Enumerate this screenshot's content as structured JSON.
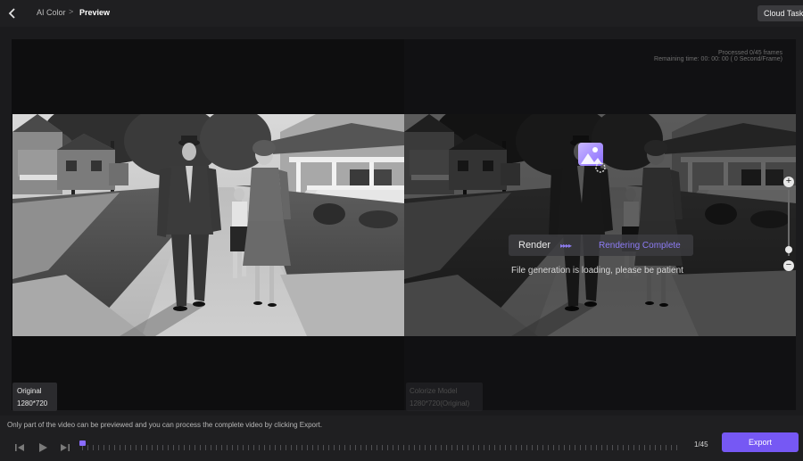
{
  "header": {
    "back_icon": "chevron-left-icon",
    "breadcrumb_parent": "AI Color",
    "breadcrumb_separator": ">",
    "breadcrumb_current": "Preview",
    "cloud_tasks_label": "Cloud Tasks"
  },
  "preview": {
    "stats_processed": "Processed 0/45 frames",
    "stats_remaining": "Remaining time: 00: 00: 00 ( 0 Second/Frame)",
    "original_tag_title": "Original",
    "original_tag_resolution": "1280*720",
    "model_tag_title": "Colorize Model",
    "model_tag_resolution": "1280*720(Original)"
  },
  "render": {
    "icon": "image-loading-icon",
    "label": "Render",
    "arrows": "▸▸▸▸",
    "status": "Rendering Complete",
    "message": "File generation is loading, please be patient"
  },
  "zoom": {
    "plus": "+",
    "minus": "−",
    "level": 0.1
  },
  "bottom": {
    "notice": "Only part of the video can be previewed and you can process the complete video by clicking Export.",
    "frame_counter": "1/45",
    "export_label": "Export",
    "controls": [
      "step-back-icon",
      "play-icon",
      "step-forward-icon"
    ]
  },
  "colors": {
    "accent": "#7658f4",
    "accent_text": "#8d7cf5",
    "background": "#1b1b1d"
  }
}
